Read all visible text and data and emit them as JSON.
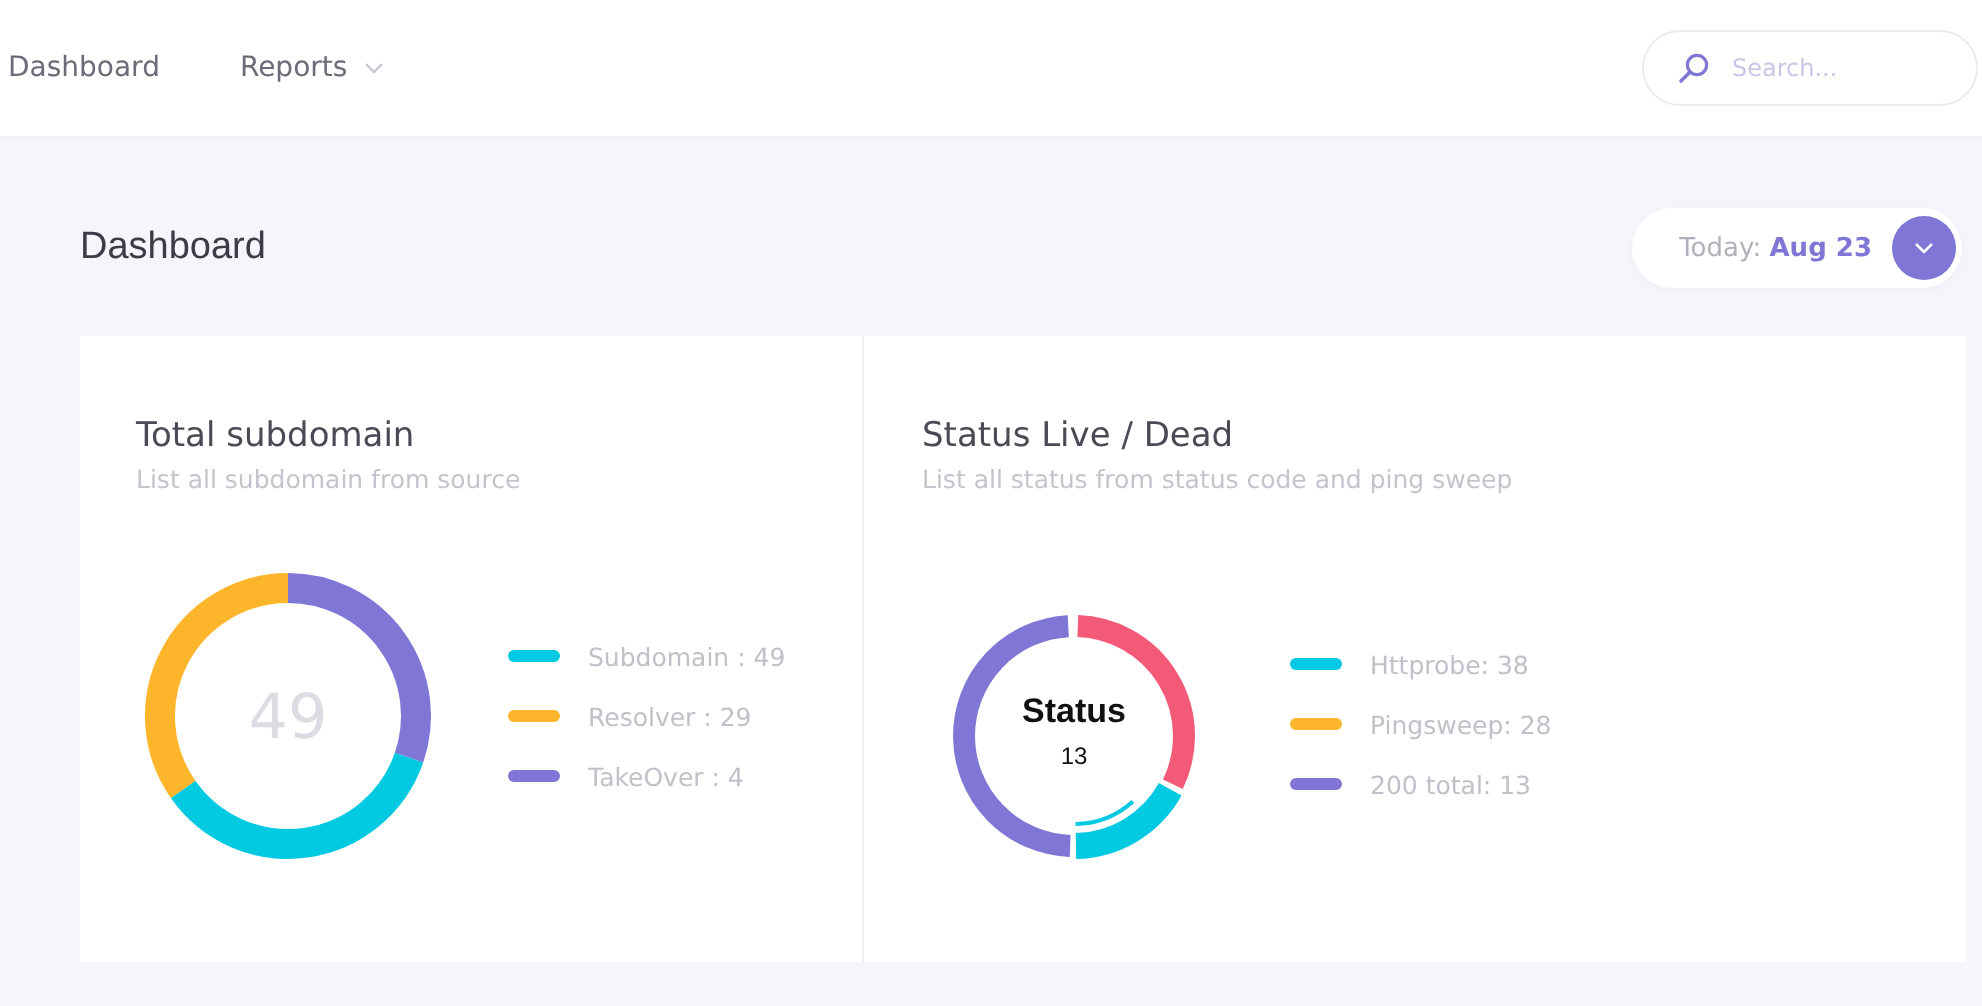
{
  "nav": {
    "items": [
      {
        "label": "Dashboard",
        "dropdown": false
      },
      {
        "label": "Reports",
        "dropdown": true
      }
    ]
  },
  "search": {
    "placeholder": "Search..."
  },
  "page": {
    "title": "Dashboard",
    "date_label": "Today:",
    "date_value": "Aug 23"
  },
  "cards": [
    {
      "title": "Total subdomain",
      "subtitle": "List all subdomain from source",
      "kind": "total",
      "center_value": "49",
      "legend": [
        {
          "label": "Subdomain : 49",
          "color": "#00c9e2"
        },
        {
          "label": "Resolver : 29",
          "color": "#fdb62b"
        },
        {
          "label": "TakeOver : 4",
          "color": "#7f76d5"
        }
      ]
    },
    {
      "title": "Status Live / Dead",
      "subtitle": "List all status from status code and ping sweep",
      "kind": "status",
      "center_title": "Status",
      "center_value": "13",
      "legend": [
        {
          "label": "Httprobe: 38",
          "color": "#00c9e2"
        },
        {
          "label": "Pingsweep: 28",
          "color": "#fdb62b"
        },
        {
          "label": "200 total: 13",
          "color": "#7f76d5"
        }
      ]
    }
  ]
}
